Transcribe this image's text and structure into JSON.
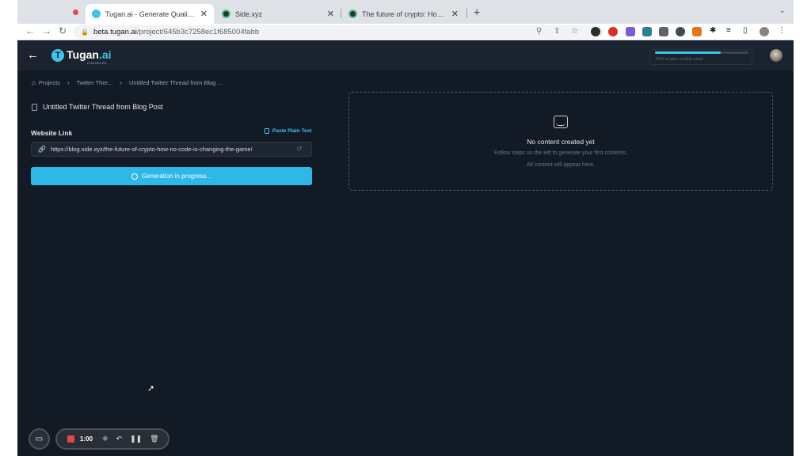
{
  "browser": {
    "tabs": [
      {
        "title": "Tugan.ai - Generate Quality Ma",
        "active": true
      },
      {
        "title": "Side.xyz",
        "active": false
      },
      {
        "title": "The future of crypto: How no-c",
        "active": false
      }
    ],
    "close_glyph": "✕",
    "new_tab_glyph": "+",
    "url_host": "beta.tugan.ai",
    "url_path": "/project/645b3c7258ec1f685004fabb"
  },
  "app": {
    "logo_name": "Tugan",
    "logo_suffix": ".ai",
    "logo_tagline": "ENHANCED",
    "credits_text": "70% of plan credits used",
    "credits_fraction": 0.7
  },
  "breadcrumb": {
    "items": [
      "Projects",
      "Twitter Thre...",
      "Untitled Twitter Thread from Blog ..."
    ]
  },
  "project": {
    "title": "Untitled Twitter Thread from Blog Post",
    "link_label": "Website Link",
    "paste_label": "Paste Plain Text",
    "link_value": "https://blog.side.xyz/the-future-of-crypto-how-no-code-is-changing-the-game/",
    "generate_label": "Generation in progress..."
  },
  "empty_state": {
    "title": "No content created yet",
    "subtitle": "Follow steps on the left to generate your first contents.",
    "note": "All content will appear here."
  },
  "recorder": {
    "time": "1:00"
  },
  "colors": {
    "accent": "#2eb8ea",
    "background": "#121a26",
    "record": "#e24a4a"
  }
}
